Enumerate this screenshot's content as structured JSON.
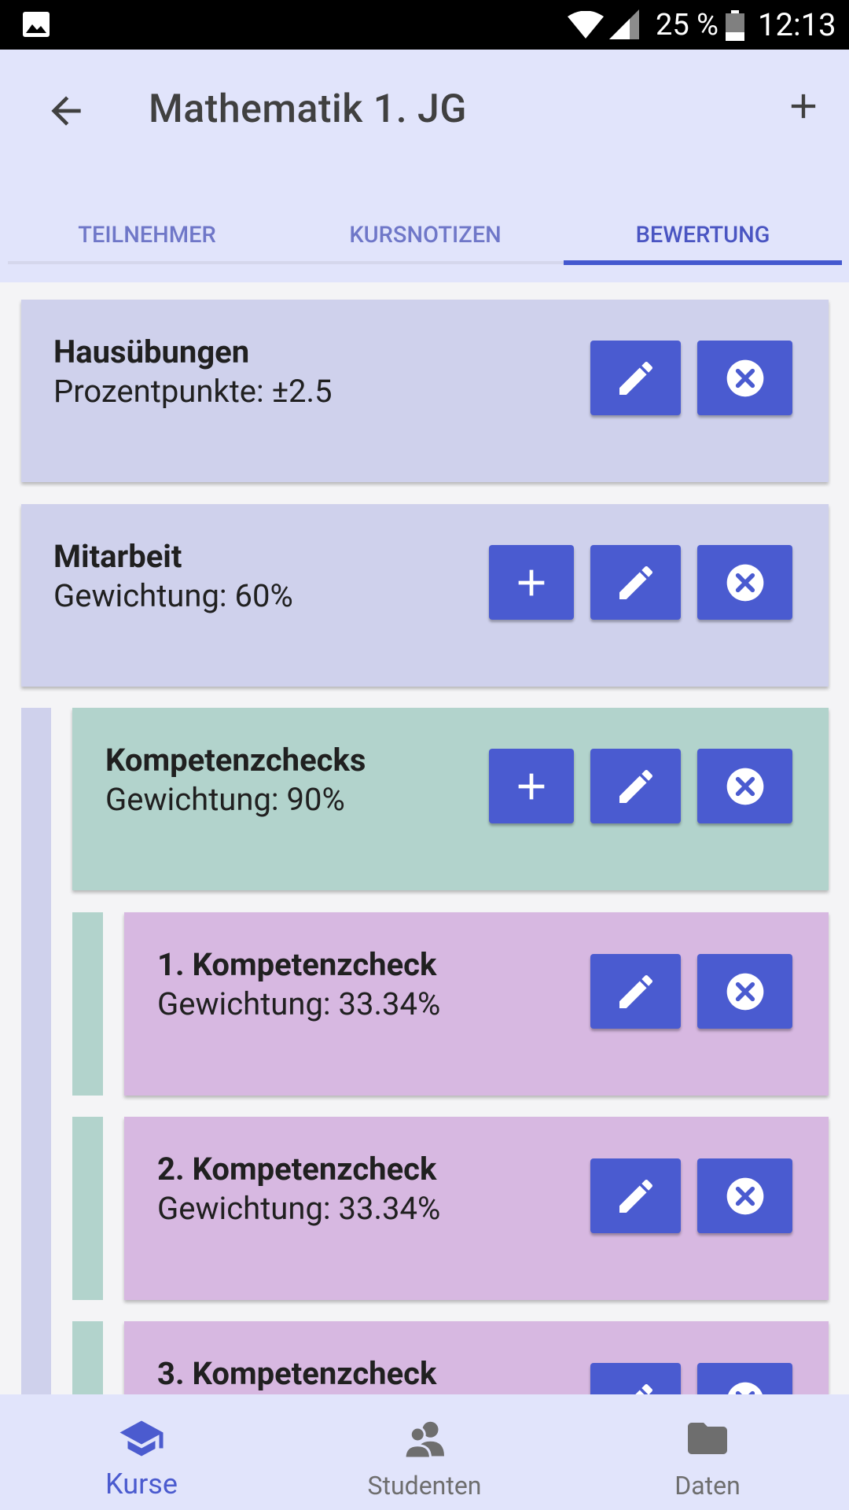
{
  "status": {
    "battery_pct": "25 %",
    "time": "12:13"
  },
  "appbar": {
    "title": "Mathematik 1. JG"
  },
  "tabs": [
    {
      "label": "TEILNEHMER"
    },
    {
      "label": "KURSNOTIZEN"
    },
    {
      "label": "BEWERTUNG"
    }
  ],
  "cards": [
    {
      "name": "Hausübungen",
      "sub": "Prozentpunkte: ±2.5"
    },
    {
      "name": "Mitarbeit",
      "sub": "Gewichtung: 60%"
    },
    {
      "name": "Kompetenzchecks",
      "sub": "Gewichtung: 90%"
    },
    {
      "name": "1. Kompetenzcheck",
      "sub": "Gewichtung: 33.34%"
    },
    {
      "name": "2. Kompetenzcheck",
      "sub": "Gewichtung: 33.34%"
    },
    {
      "name": "3. Kompetenzcheck",
      "sub": ""
    }
  ],
  "colors": {
    "accent": "#4a5bd0",
    "level1": "#cfd1ec",
    "level2": "#b2d3cc",
    "level3": "#d7b8e1"
  },
  "bottomnav": [
    {
      "label": "Kurse",
      "icon": "graduation-cap-icon"
    },
    {
      "label": "Studenten",
      "icon": "people-icon"
    },
    {
      "label": "Daten",
      "icon": "folder-icon"
    }
  ]
}
